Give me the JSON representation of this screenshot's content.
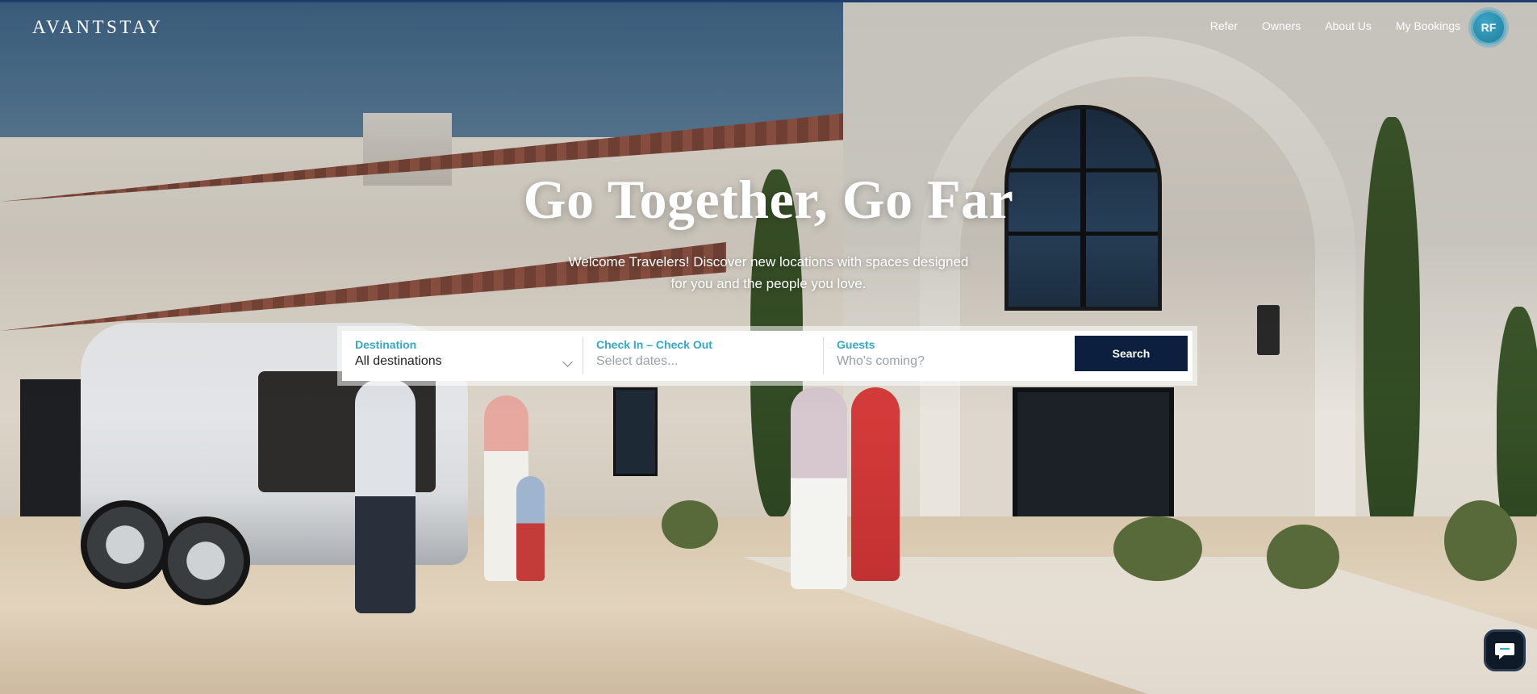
{
  "header": {
    "logo": "AVANTSTAY",
    "nav": [
      {
        "label": "Refer"
      },
      {
        "label": "Owners"
      },
      {
        "label": "About Us"
      },
      {
        "label": "My Bookings"
      }
    ],
    "avatar_initials": "RF"
  },
  "hero": {
    "headline": "Go Together, Go Far",
    "subtitle": "Welcome Travelers! Discover new locations with spaces designed for you and the people you love."
  },
  "search": {
    "destination": {
      "label": "Destination",
      "value": "All destinations"
    },
    "dates": {
      "label": "Check In – Check Out",
      "placeholder": "Select dates..."
    },
    "guests": {
      "label": "Guests",
      "placeholder": "Who's coming?"
    },
    "button_label": "Search"
  },
  "colors": {
    "accent": "#35a8c4",
    "button": "#0c1f3f",
    "avatar": "#1f7e9f"
  },
  "icons": {
    "destination_dropdown": "chevron-down-icon",
    "chat": "chat-bubble-icon"
  }
}
